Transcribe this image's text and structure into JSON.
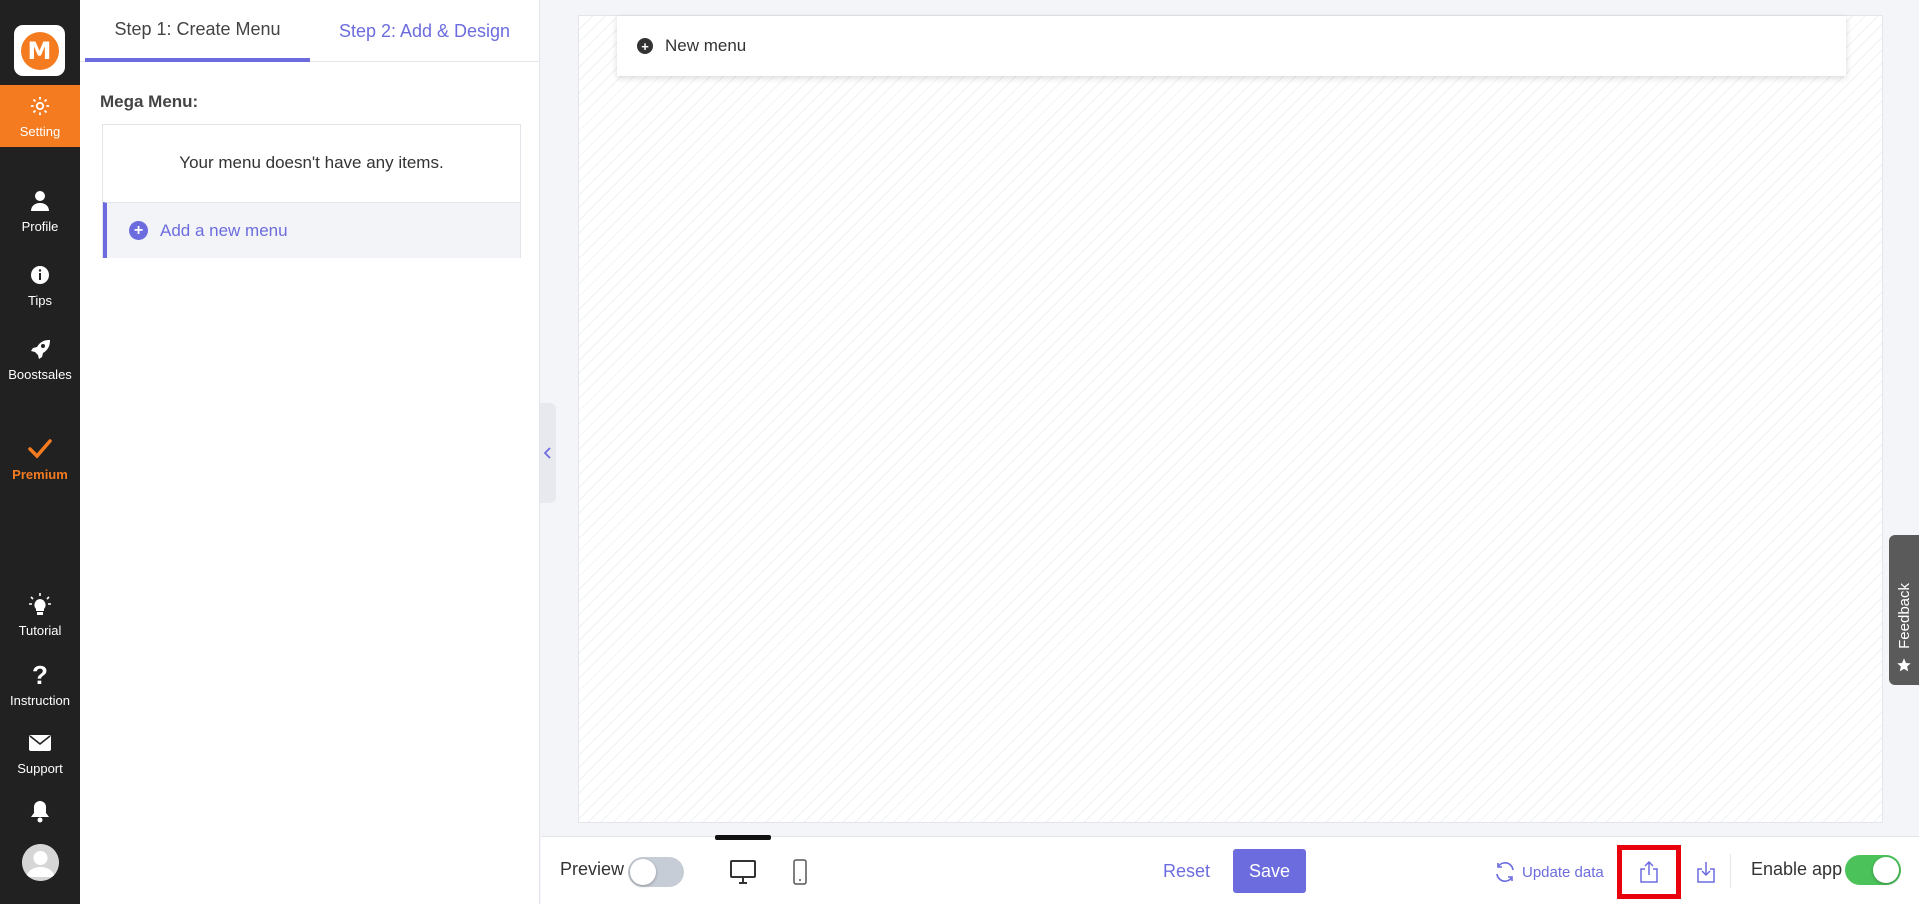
{
  "app": {
    "logo_letter": "M",
    "accent": "#6c6cde",
    "brand": "#f47b20"
  },
  "sidebar": {
    "items": [
      {
        "label": "Setting",
        "icon": "gear-icon",
        "active": true
      },
      {
        "label": "Profile",
        "icon": "user-icon"
      },
      {
        "label": "Tips",
        "icon": "info-icon"
      },
      {
        "label": "Boostsales",
        "icon": "rocket-icon"
      },
      {
        "label": "Premium",
        "icon": "checkmark-icon"
      },
      {
        "label": "Tutorial",
        "icon": "lightbulb-icon"
      },
      {
        "label": "Instruction",
        "icon": "question-icon"
      },
      {
        "label": "Support",
        "icon": "envelope-icon"
      }
    ],
    "bell_icon": "bell-icon",
    "avatar_icon": "avatar-icon"
  },
  "panel": {
    "tabs": [
      {
        "label": "Step 1: Create Menu",
        "active": true
      },
      {
        "label": "Step 2: Add & Design"
      }
    ],
    "mega_menu_label": "Mega Menu:",
    "empty_text": "Your menu doesn't have any items.",
    "add_new_menu": "Add a new menu"
  },
  "canvas": {
    "new_menu_label": "New menu"
  },
  "toolbar": {
    "preview_label": "Preview",
    "preview_on": false,
    "reset_label": "Reset",
    "save_label": "Save",
    "update_data_label": "Update data",
    "enable_app_label": "Enable app",
    "enable_app_on": true
  },
  "feedback": {
    "label": "Feedback"
  }
}
